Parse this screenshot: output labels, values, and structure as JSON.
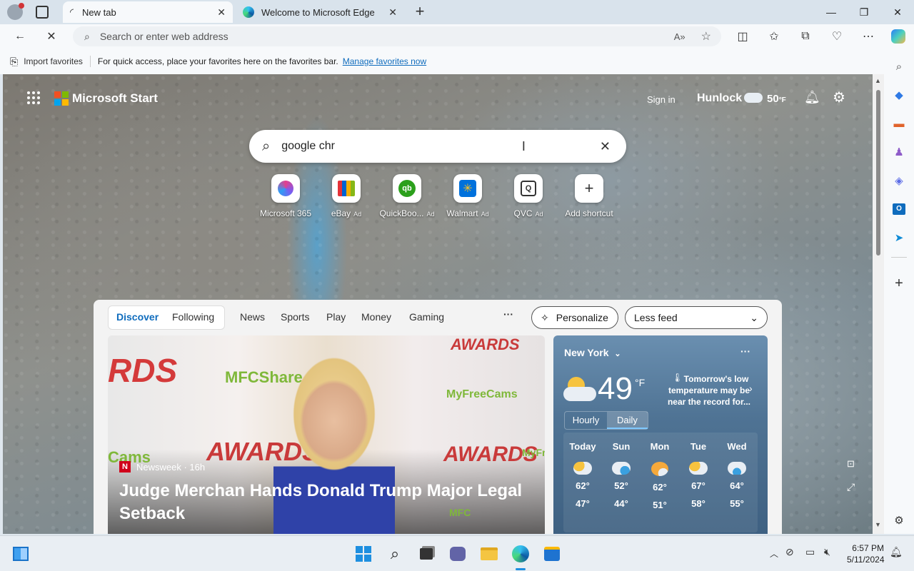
{
  "tabs": [
    {
      "label": "New tab",
      "active": true
    },
    {
      "label": "Welcome to Microsoft Edge",
      "active": false
    }
  ],
  "address": {
    "placeholder": "Search or enter web address"
  },
  "favorites_bar": {
    "import_label": "Import favorites",
    "hint": "For quick access, place your favorites here on the favorites bar.",
    "manage_link": "Manage favorites now"
  },
  "header": {
    "brand": "Microsoft Start",
    "sign_in": "Sign in",
    "location": "Hunlock",
    "temp": "50",
    "temp_unit": "°F"
  },
  "search": {
    "value": "google chr"
  },
  "shortcuts": [
    {
      "label": "Microsoft 365",
      "ad": "",
      "icon": "m365-icon"
    },
    {
      "label": "eBay",
      "ad": "Ad",
      "icon": "ebay-icon"
    },
    {
      "label": "QuickBoo...",
      "ad": "Ad",
      "icon": "quickbooks-icon"
    },
    {
      "label": "Walmart",
      "ad": "Ad",
      "icon": "walmart-icon"
    },
    {
      "label": "QVC",
      "ad": "Ad",
      "icon": "qvc-icon"
    },
    {
      "label": "Add shortcut",
      "ad": "",
      "icon": "plus-icon"
    }
  ],
  "feed": {
    "nav": [
      "Discover",
      "Following",
      "News",
      "Sports",
      "Play",
      "Money",
      "Gaming"
    ],
    "more": "···",
    "personalize": "Personalize",
    "feed_select": "Less feed",
    "hero": {
      "source": "Newsweek · 16h",
      "headline": "Judge Merchan Hands Donald Trump Major Legal Setback",
      "bg_words": [
        "RDS",
        "MFCShare",
        "AWARDS",
        "MyFreeCams",
        "Cams",
        "AWARDS",
        "AWARDS",
        "MyFr",
        "MFC"
      ]
    }
  },
  "weather": {
    "city": "New York",
    "temp": "49",
    "unit": "°F",
    "note": "Tomorrow's low temperature may be near the record for...",
    "tabs": [
      "Hourly",
      "Daily"
    ],
    "days": [
      {
        "day": "Today",
        "hi": "62°",
        "lo": "47°"
      },
      {
        "day": "Sun",
        "hi": "52°",
        "lo": "44°"
      },
      {
        "day": "Mon",
        "hi": "62°",
        "lo": "51°"
      },
      {
        "day": "Tue",
        "hi": "67°",
        "lo": "58°"
      },
      {
        "day": "Wed",
        "hi": "64°",
        "lo": "55°"
      }
    ]
  },
  "clock": {
    "time": "6:57 PM",
    "date": "5/11/2024"
  },
  "colors": {
    "accent": "#0f6cbd",
    "brand_link": "#0f6cbd"
  }
}
